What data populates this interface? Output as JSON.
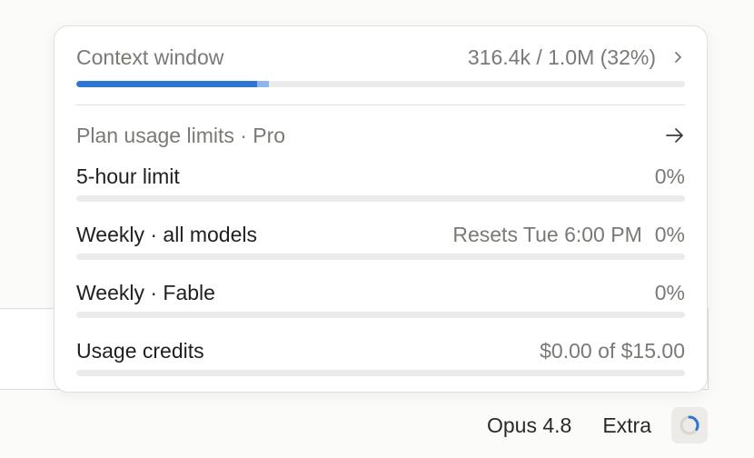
{
  "context_window": {
    "title": "Context window",
    "value": "316.4k / 1.0M (32%)",
    "fraction": 0.316
  },
  "plan": {
    "title": "Plan usage limits · Pro"
  },
  "limits": [
    {
      "label": "5-hour limit",
      "note": "",
      "value": "0%",
      "fraction": 0
    },
    {
      "label": "Weekly · all models",
      "note": "Resets Tue 6:00 PM",
      "value": "0%",
      "fraction": 0
    },
    {
      "label": "Weekly · Fable",
      "note": "",
      "value": "0%",
      "fraction": 0
    },
    {
      "label": "Usage credits",
      "note": "",
      "value": "$0.00 of $15.00",
      "fraction": 0
    }
  ],
  "footer": {
    "model": "Opus 4.8",
    "mode": "Extra"
  },
  "colors": {
    "accent": "#2f76d2",
    "track": "#ebebea",
    "muted_text": "#7a7974"
  },
  "icons": {
    "context_chevron": "chevron-right-icon",
    "plan_arrow": "arrow-right-icon",
    "status": "progress-ring-icon"
  }
}
